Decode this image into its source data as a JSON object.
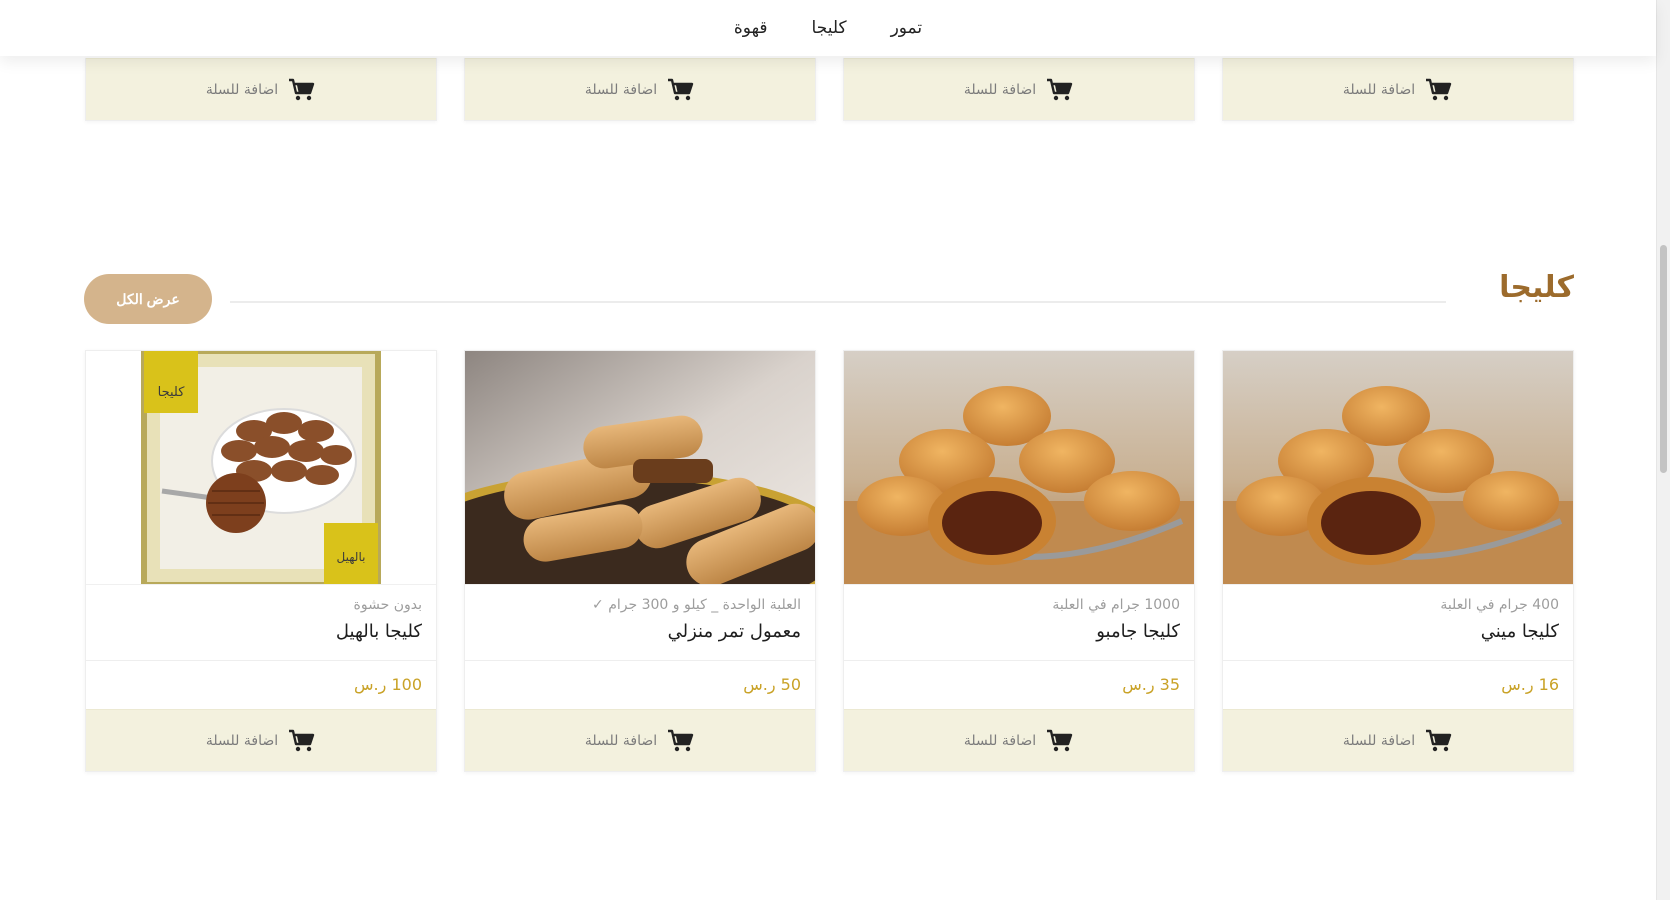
{
  "nav": {
    "items": [
      "تمور",
      "كليجا",
      "قهوة"
    ]
  },
  "common": {
    "add_to_cart": "اضافة للسلة"
  },
  "section": {
    "title": "كليجا",
    "view_all": "عرض الكل"
  },
  "products": [
    {
      "meta": "400 جرام في العلبة",
      "title": "كليجا ميني",
      "price": "16 ر.س",
      "image": "filled-kleicha"
    },
    {
      "meta": "1000 جرام في العلبة",
      "title": "كليجا جامبو",
      "price": "35 ر.س",
      "image": "filled-kleicha"
    },
    {
      "meta": "العلبة الواحدة _ كيلو و 300 جرام ✓",
      "title": "معمول تمر منزلي",
      "price": "50 ر.س",
      "image": "date-maamoul"
    },
    {
      "meta": "بدون حشوة",
      "title": "كليجا بالهيل",
      "price": "100 ر.س",
      "image": "cardamom-kleicha-package"
    }
  ],
  "package_labels": {
    "top": "كليجا",
    "bottom": "بالهيل"
  },
  "colors": {
    "accent_brown": "#9c6b2c",
    "price_gold": "#c9a227",
    "cart_button_bg": "#f3f1de",
    "view_all_bg": "#d4b48c"
  }
}
